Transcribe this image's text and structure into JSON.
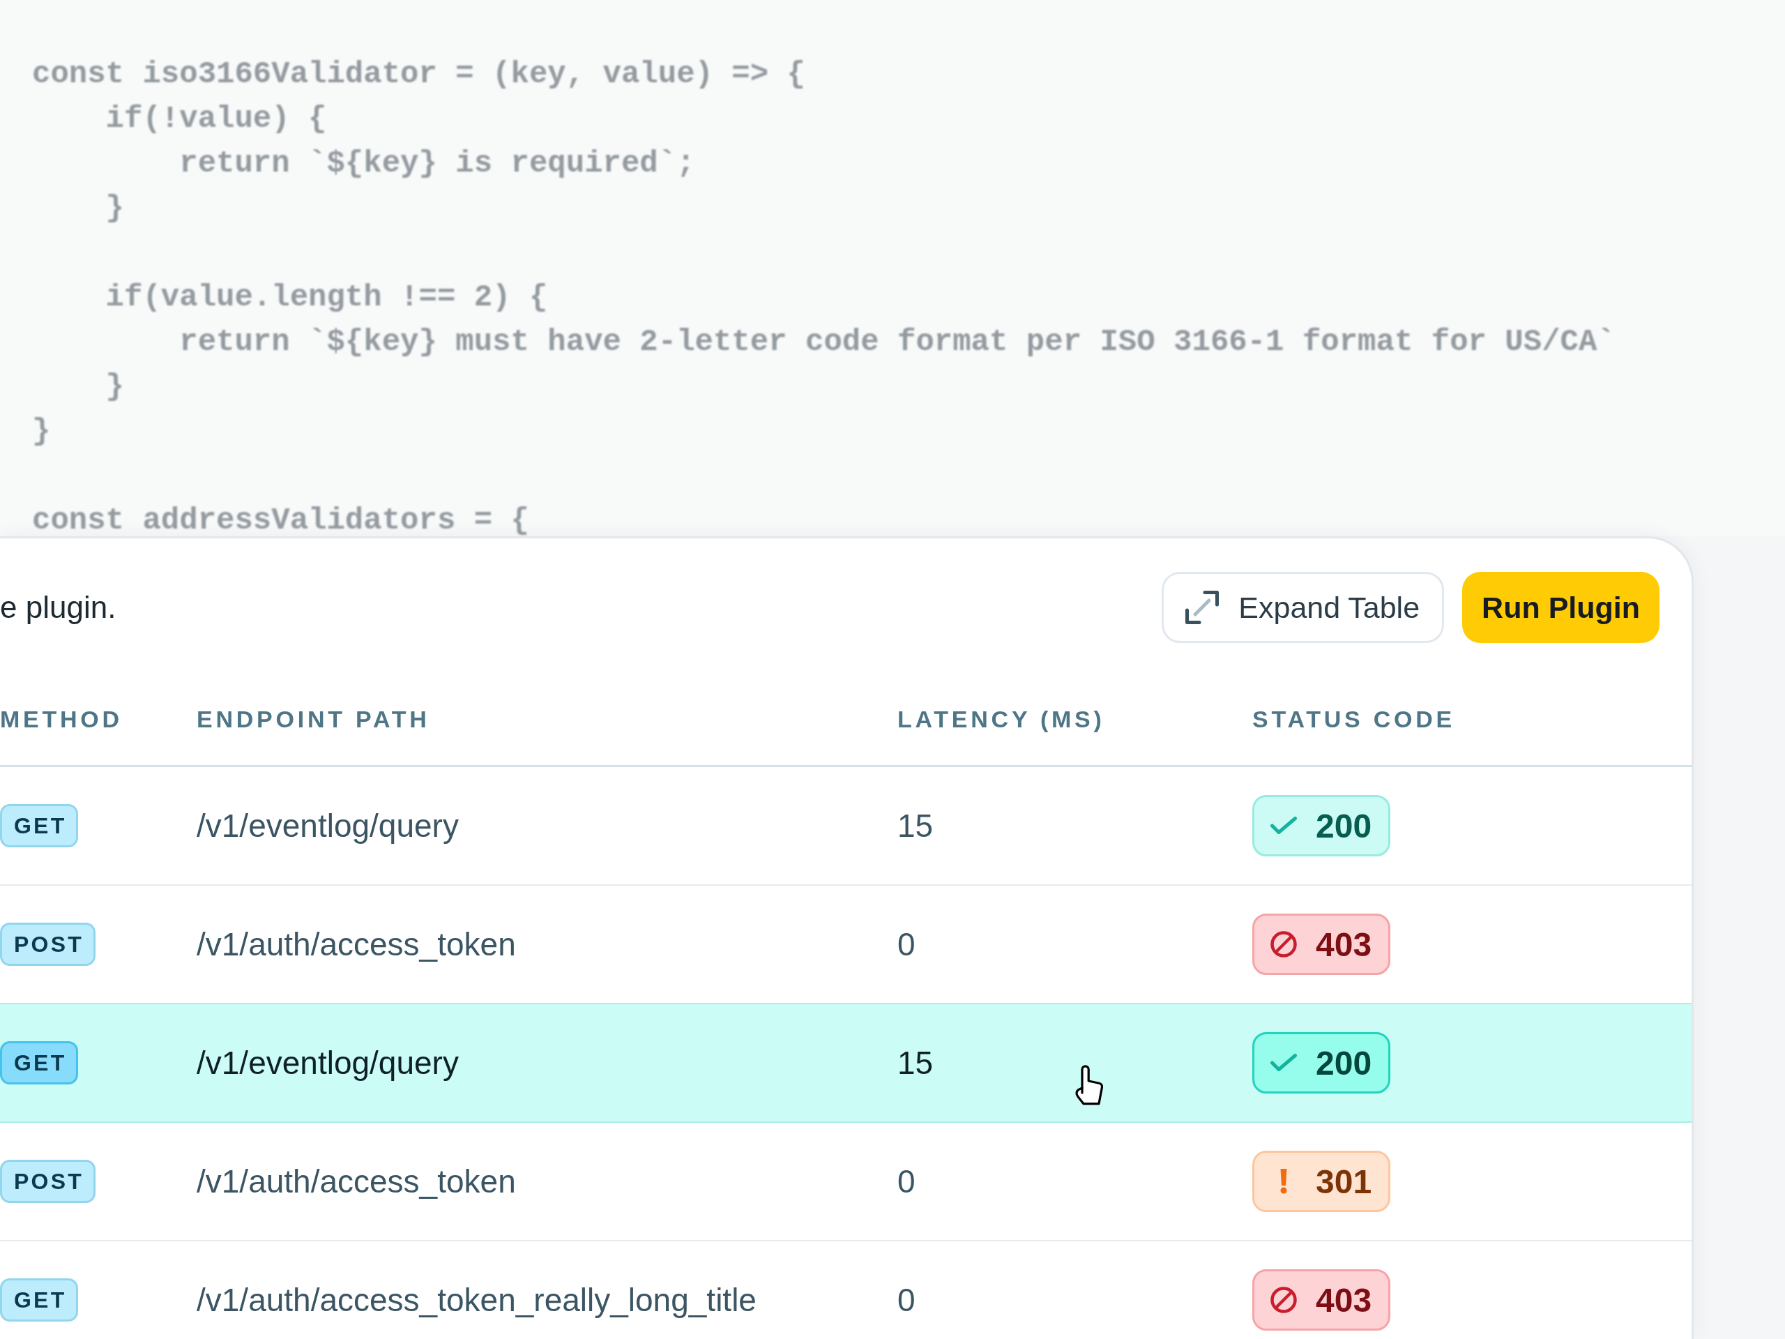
{
  "code": {
    "lines": [
      {
        "kind": "code",
        "text": "const iso3166Validator = (key, value) => {",
        "children": [
          {
            "kind": "code",
            "text": "if(!value) {",
            "children": [
              {
                "kind": "code",
                "text": "return `${key} is required`;"
              }
            ]
          },
          {
            "kind": "code",
            "text": "}"
          },
          {
            "kind": "blank"
          },
          {
            "kind": "code",
            "text": "if(value.length !== 2) {",
            "children": [
              {
                "kind": "code",
                "text": "return `${key} must have 2-letter code format per ISO 3166-1 format for US/CA`"
              }
            ]
          },
          {
            "kind": "code",
            "text": "}"
          }
        ]
      },
      {
        "kind": "code",
        "text": "}"
      },
      {
        "kind": "blank"
      },
      {
        "kind": "code",
        "text": "const addressValidators = {"
      }
    ]
  },
  "toolbar": {
    "description": "e plugin.",
    "buttons": [
      {
        "label": "Expand Table",
        "kind": "secondary"
      },
      {
        "label": "Run Plugin",
        "kind": "primary"
      }
    ]
  },
  "table": {
    "columns": [
      "METHOD",
      "ENDPOINT PATH",
      "LATENCY (MS)",
      "STATUS CODE"
    ],
    "rows": [
      {
        "method": "GET",
        "path": "/v1/eventlog/query",
        "latency": "15",
        "status": {
          "code": "200",
          "kind": "success"
        },
        "selected": false
      },
      {
        "method": "POST",
        "path": "/v1/auth/access_token",
        "latency": "0",
        "status": {
          "code": "403",
          "kind": "error"
        },
        "selected": false
      },
      {
        "method": "GET",
        "path": "/v1/eventlog/query",
        "latency": "15",
        "status": {
          "code": "200",
          "kind": "success"
        },
        "selected": true
      },
      {
        "method": "POST",
        "path": "/v1/auth/access_token",
        "latency": "0",
        "status": {
          "code": "301",
          "kind": "warning"
        },
        "selected": false
      },
      {
        "method": "GET",
        "path": "/v1/auth/access_token_really_long_title",
        "latency": "0",
        "status": {
          "code": "403",
          "kind": "error"
        },
        "selected": false
      }
    ]
  }
}
